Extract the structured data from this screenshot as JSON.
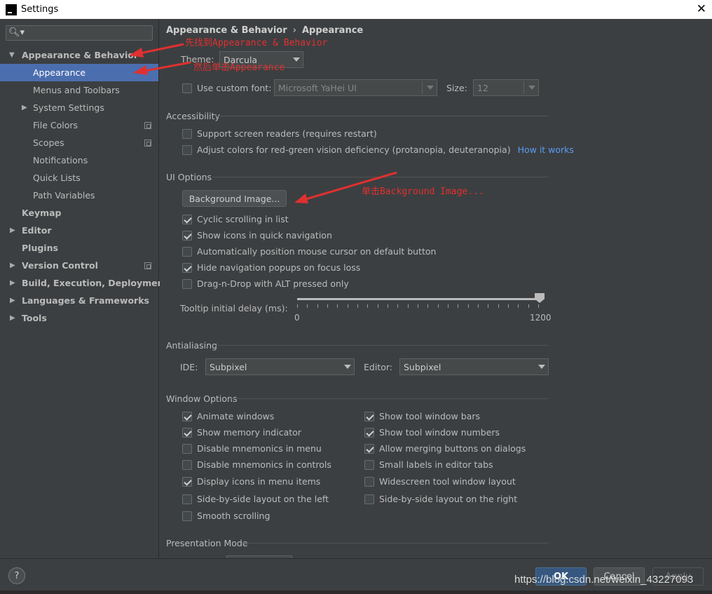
{
  "window": {
    "title": "Settings",
    "close_glyph": "✕"
  },
  "sidebar": {
    "search_placeholder": "",
    "items": [
      {
        "label": "Appearance & Behavior",
        "bold": true,
        "expanded": true
      },
      {
        "label": "Appearance",
        "selected": true
      },
      {
        "label": "Menus and Toolbars"
      },
      {
        "label": "System Settings"
      },
      {
        "label": "File Colors"
      },
      {
        "label": "Scopes"
      },
      {
        "label": "Notifications"
      },
      {
        "label": "Quick Lists"
      },
      {
        "label": "Path Variables"
      },
      {
        "label": "Keymap",
        "bold": true
      },
      {
        "label": "Editor",
        "bold": true
      },
      {
        "label": "Plugins",
        "bold": true
      },
      {
        "label": "Version Control",
        "bold": true
      },
      {
        "label": "Build, Execution, Deployment",
        "bold": true
      },
      {
        "label": "Languages & Frameworks",
        "bold": true
      },
      {
        "label": "Tools",
        "bold": true
      }
    ]
  },
  "breadcrumb": {
    "parent": "Appearance & Behavior",
    "separator": "›",
    "current": "Appearance"
  },
  "theme": {
    "label": "Theme:",
    "value": "Darcula"
  },
  "custom_font": {
    "label": "Use custom font:",
    "checked": false,
    "font": "Microsoft YaHei UI",
    "size_label": "Size:",
    "size": "12"
  },
  "accessibility": {
    "title": "Accessibility",
    "screen_readers": {
      "label": "Support screen readers (requires restart)",
      "checked": false
    },
    "color_adjust": {
      "label": "Adjust colors for red-green vision deficiency (protanopia, deuteranopia)",
      "checked": false
    },
    "how_it_works": "How it works"
  },
  "ui_options": {
    "title": "UI Options",
    "background_image_button": "Background Image...",
    "cyclic_scrolling": {
      "label": "Cyclic scrolling in list",
      "checked": true
    },
    "show_icons": {
      "label": "Show icons in quick navigation",
      "checked": true
    },
    "auto_mouse": {
      "label": "Automatically position mouse cursor on default button",
      "checked": false
    },
    "hide_nav_popups": {
      "label": "Hide navigation popups on focus loss",
      "checked": true
    },
    "drag_n_drop": {
      "label": "Drag-n-Drop with ALT pressed only",
      "checked": false
    },
    "tooltip_delay": {
      "label": "Tooltip initial delay (ms):",
      "min": "0",
      "max": "1200",
      "value": 1200
    }
  },
  "antialiasing": {
    "title": "Antialiasing",
    "ide_label": "IDE:",
    "ide_value": "Subpixel",
    "editor_label": "Editor:",
    "editor_value": "Subpixel"
  },
  "window_options": {
    "title": "Window Options",
    "left": [
      {
        "label": "Animate windows",
        "checked": true
      },
      {
        "label": "Show memory indicator",
        "checked": true
      },
      {
        "label": "Disable mnemonics in menu",
        "checked": false
      },
      {
        "label": "Disable mnemonics in controls",
        "checked": false
      },
      {
        "label": "Display icons in menu items",
        "checked": true
      },
      {
        "label": "Side-by-side layout on the left",
        "checked": false
      },
      {
        "label": "Smooth scrolling",
        "checked": false
      }
    ],
    "right": [
      {
        "label": "Show tool window bars",
        "checked": true
      },
      {
        "label": "Show tool window numbers",
        "checked": true
      },
      {
        "label": "Allow merging buttons on dialogs",
        "checked": true
      },
      {
        "label": "Small labels in editor tabs",
        "checked": false
      },
      {
        "label": "Widescreen tool window layout",
        "checked": false
      },
      {
        "label": "Side-by-side layout on the right",
        "checked": false
      }
    ]
  },
  "presentation_mode": {
    "title": "Presentation Mode"
  },
  "footer": {
    "help": "?",
    "ok": "OK",
    "cancel": "Cancel",
    "apply": "Apply"
  },
  "annotations": {
    "find_appearance_behavior": "先找到Appearance & Behavior",
    "then_click_appearance": "然后单击Appearance",
    "click_background_image": "单击Background Image..."
  },
  "watermark": "https://blog.csdn.net/weixin_43227093",
  "colors": {
    "annotation": "#e03030",
    "selection": "#4b6eaf",
    "link": "#589df6",
    "ok_button": "#365880"
  }
}
